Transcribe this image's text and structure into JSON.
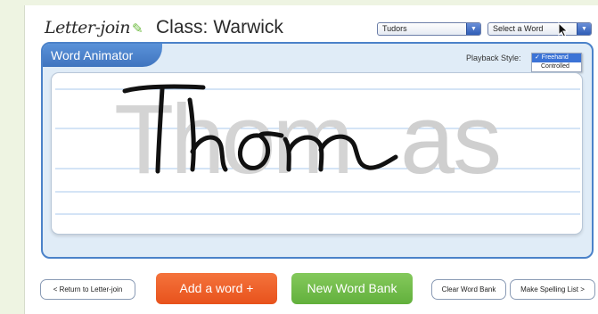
{
  "header": {
    "logo_text": "Letter-join",
    "class_prefix": "Class:",
    "class_name": "Warwick",
    "topic_select": {
      "value": "Tudors"
    },
    "word_select": {
      "value": "Select a Word"
    }
  },
  "panel": {
    "title": "Word Animator",
    "playback_label": "Playback Style:",
    "playback_options": [
      {
        "label": "✓ Freehand",
        "selected": true
      },
      {
        "label": "Controlled",
        "selected": false
      }
    ],
    "word": {
      "written": "Thom",
      "remaining": "as"
    }
  },
  "footer": {
    "return_label": "< Return to Letter-join",
    "add_word_label": "Add a word +",
    "new_bank_label": "New Word Bank",
    "clear_bank_label": "Clear Word Bank",
    "spelling_list_label": "Make Spelling List >"
  },
  "colors": {
    "accent_blue": "#4b82c9",
    "add_word_orange": "#f0602a",
    "new_bank_green": "#72bd4a",
    "pencil_green": "#6dbb3f"
  },
  "icons": [
    "pencil-icon",
    "dropdown-arrow-icon",
    "mouse-cursor-icon",
    "checkmark-icon"
  ]
}
